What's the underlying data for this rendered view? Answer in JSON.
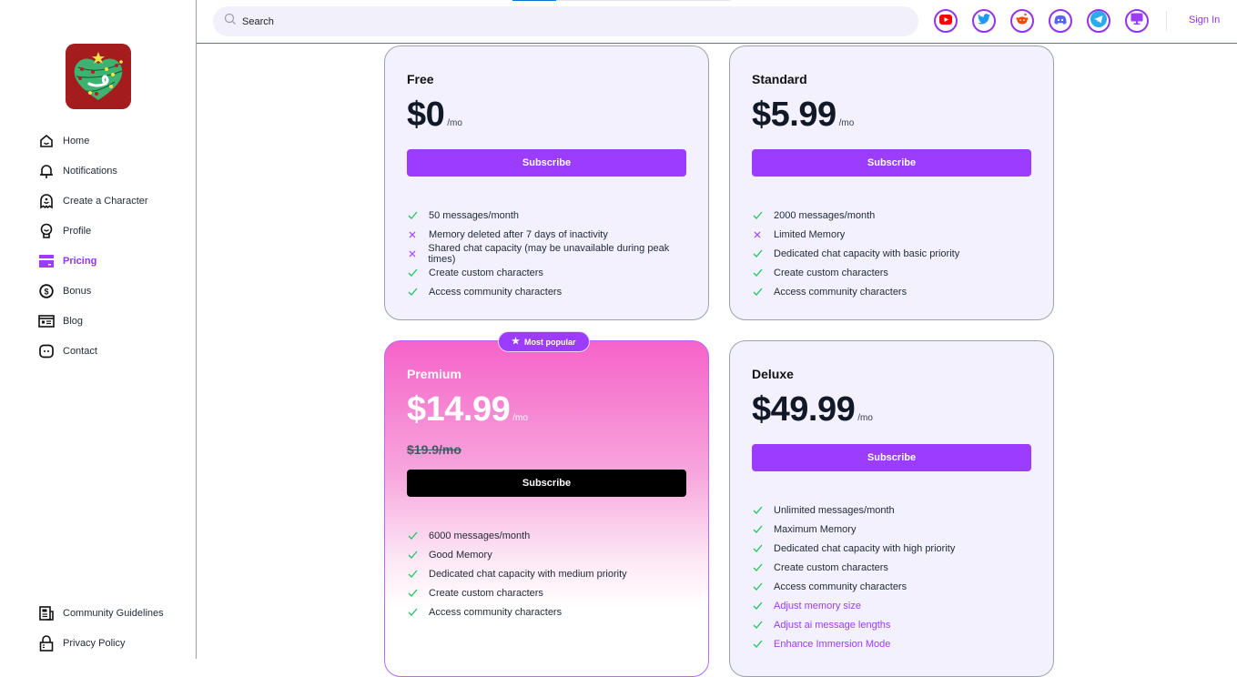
{
  "sidebar": {
    "logo_alt": "Christmas heart app logo",
    "nav": [
      {
        "label": "Home",
        "icon": "home-icon",
        "active": false
      },
      {
        "label": "Notifications",
        "icon": "bell-icon",
        "active": false
      },
      {
        "label": "Create a Character",
        "icon": "ghost-icon",
        "active": false
      },
      {
        "label": "Profile",
        "icon": "profile-icon",
        "active": false
      },
      {
        "label": "Pricing",
        "icon": "card-icon",
        "active": true
      },
      {
        "label": "Bonus",
        "icon": "dollar-coin-icon",
        "active": false
      },
      {
        "label": "Blog",
        "icon": "blog-icon",
        "active": false
      },
      {
        "label": "Contact",
        "icon": "chat-icon",
        "active": false
      }
    ],
    "bottom": [
      {
        "label": "Community Guidelines",
        "icon": "document-icon"
      },
      {
        "label": "Privacy Policy",
        "icon": "lock-icon"
      }
    ]
  },
  "topbar": {
    "search_placeholder": "Search",
    "loading_progress_percent": 20,
    "socials": [
      "youtube",
      "twitter",
      "reddit",
      "discord",
      "telegram",
      "desktop-app"
    ],
    "sign_in": "Sign In"
  },
  "colors": {
    "accent": "#9b3cff",
    "check": "#22c55e",
    "cross": "#a855f7"
  },
  "plans": [
    {
      "name": "Free",
      "price": "$0",
      "per": "/mo",
      "button": "Subscribe",
      "features": [
        {
          "text": "50 messages/month",
          "ok": true
        },
        {
          "text": "Memory deleted after 7 days of inactivity",
          "ok": false
        },
        {
          "text": "Shared chat capacity (may be unavailable during peak times)",
          "ok": false
        },
        {
          "text": "Create custom characters",
          "ok": true
        },
        {
          "text": "Access community characters",
          "ok": true
        }
      ]
    },
    {
      "name": "Standard",
      "price": "$5.99",
      "per": "/mo",
      "button": "Subscribe",
      "features": [
        {
          "text": "2000 messages/month",
          "ok": true
        },
        {
          "text": "Limited Memory",
          "ok": false
        },
        {
          "text": "Dedicated chat capacity with basic priority",
          "ok": true
        },
        {
          "text": "Create custom characters",
          "ok": true
        },
        {
          "text": "Access community characters",
          "ok": true
        }
      ]
    },
    {
      "name": "Premium",
      "badge": "Most popular",
      "price": "$14.99",
      "per": "/mo",
      "old_price": "$19.9/mo",
      "button": "Subscribe",
      "features": [
        {
          "text": "6000 messages/month",
          "ok": true
        },
        {
          "text": "Good Memory",
          "ok": true
        },
        {
          "text": "Dedicated chat capacity with medium priority",
          "ok": true
        },
        {
          "text": "Create custom characters",
          "ok": true
        },
        {
          "text": "Access community characters",
          "ok": true
        }
      ]
    },
    {
      "name": "Deluxe",
      "price": "$49.99",
      "per": "/mo",
      "button": "Subscribe",
      "features": [
        {
          "text": "Unlimited messages/month",
          "ok": true
        },
        {
          "text": "Maximum Memory",
          "ok": true
        },
        {
          "text": "Dedicated chat capacity with high priority",
          "ok": true
        },
        {
          "text": "Create custom characters",
          "ok": true
        },
        {
          "text": "Access community characters",
          "ok": true
        },
        {
          "text": "Adjust memory size",
          "ok": true,
          "highlight": true
        },
        {
          "text": "Adjust ai message lengths",
          "ok": true,
          "highlight": true
        },
        {
          "text": "Enhance Immersion Mode",
          "ok": true,
          "highlight": true
        }
      ]
    }
  ]
}
